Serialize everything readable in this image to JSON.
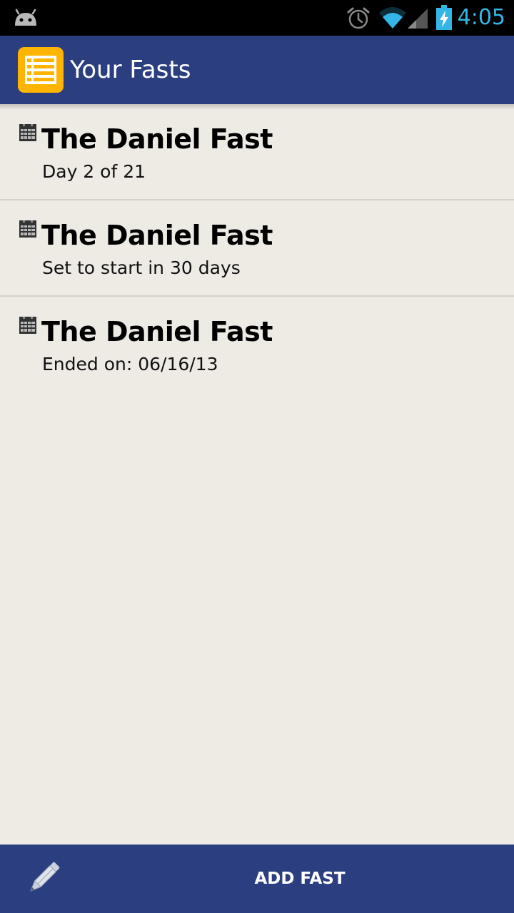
{
  "status_bar": {
    "time": "4:05",
    "icons": [
      "android-debug-icon",
      "alarm-icon",
      "wifi-icon",
      "signal-icon",
      "battery-charging-icon"
    ],
    "accent_color": "#33b5e5"
  },
  "action_bar": {
    "title": "Your Fasts",
    "icon": "list-icon",
    "background": "#2b3f80",
    "icon_color": "#ffb400"
  },
  "fasts": [
    {
      "name": "The Daniel Fast",
      "status": "Day 2 of 21"
    },
    {
      "name": "The Daniel Fast",
      "status": "Set to start in 30 days"
    },
    {
      "name": "The Daniel Fast",
      "status": "Ended on: 06/16/13"
    }
  ],
  "bottom_bar": {
    "icon": "pencil-icon",
    "add_label": "ADD FAST"
  }
}
